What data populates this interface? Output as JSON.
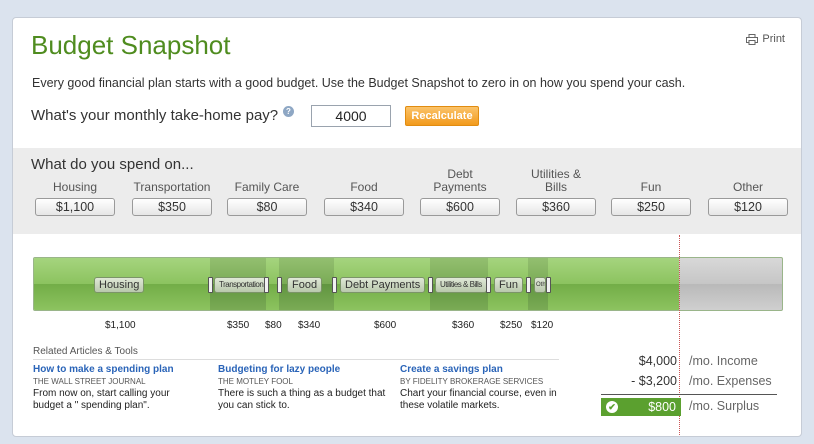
{
  "header": {
    "title": "Budget Snapshot",
    "print_label": "Print"
  },
  "intro": "Every good financial plan starts with a good budget. Use the Budget Snapshot to zero in on how you spend your cash.",
  "pay": {
    "question": "What's your monthly take-home pay?",
    "value": "4000",
    "button": "Recalculate"
  },
  "spend": {
    "title": "What do you spend on...",
    "categories": [
      {
        "label": "Housing",
        "value": "$1,100"
      },
      {
        "label": "Transportation",
        "value": "$350"
      },
      {
        "label": "Family Care",
        "value": "$80"
      },
      {
        "label": "Food",
        "value": "$340"
      },
      {
        "label": "Debt Payments",
        "value": "$600"
      },
      {
        "label": "Utilities & Bills",
        "value": "$360"
      },
      {
        "label": "Fun",
        "value": "$250"
      },
      {
        "label": "Other",
        "value": "$120"
      }
    ]
  },
  "bar": {
    "labels": [
      "Housing",
      "Transportation",
      "Food",
      "Debt Payments",
      "Utilities & Bills",
      "Fun",
      "Other"
    ],
    "amounts": [
      "$1,100",
      "$350",
      "$80",
      "$340",
      "$600",
      "$360",
      "$250",
      "$120"
    ],
    "values": [
      1100,
      350,
      80,
      340,
      600,
      360,
      250,
      120
    ],
    "income": 4000
  },
  "related": {
    "heading": "Related Articles & Tools",
    "articles": [
      {
        "title": "How to make a spending plan",
        "source": "The Wall Street Journal",
        "desc": "From now on, start calling your budget a \" spending plan\"."
      },
      {
        "title": "Budgeting for lazy people",
        "source": "The Motley Fool",
        "desc": "There is such a thing as a budget that you can stick to."
      },
      {
        "title": "Create a savings plan",
        "source": "By Fidelity Brokerage Services",
        "desc": "Chart your financial course, even in these volatile markets."
      }
    ]
  },
  "summary": {
    "income_amount": "$4,000",
    "income_label": "/mo. Income",
    "expenses_amount": "- $3,200",
    "expenses_label": "/mo. Expenses",
    "surplus_amount": "$800",
    "surplus_label": "/mo. Surplus"
  },
  "colors": {
    "brand_green": "#4f8c1f",
    "accent_orange": "#f29a1c",
    "link_blue": "#2a64b8"
  }
}
